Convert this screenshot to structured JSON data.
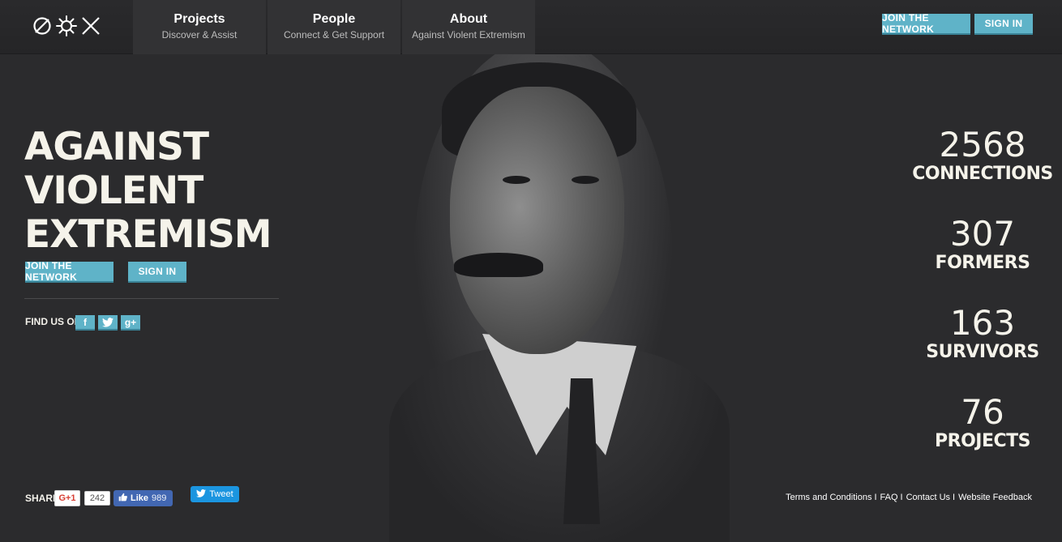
{
  "logo": {
    "icons": [
      "null-circle-icon",
      "starburst-icon",
      "x-cross-icon"
    ]
  },
  "nav": {
    "items": [
      {
        "title": "Projects",
        "subtitle": "Discover & Assist"
      },
      {
        "title": "People",
        "subtitle": "Connect & Get Support"
      },
      {
        "title": "About",
        "subtitle": "Against Violent Extremism"
      }
    ],
    "join_label": "JOIN THE NETWORK",
    "signin_label": "SIGN IN"
  },
  "hero": {
    "title_lines": [
      "AGAINST",
      "VIOLENT",
      "EXTREMISM"
    ],
    "join_label": "JOIN THE NETWORK",
    "signin_label": "SIGN IN",
    "find_us_label": "FIND US ON:",
    "social": {
      "facebook": "f",
      "twitter": "t",
      "googleplus": "g+"
    }
  },
  "stats": [
    {
      "value": "2568",
      "label": "CONNECTIONS"
    },
    {
      "value": "307",
      "label": "FORMERS"
    },
    {
      "value": "163",
      "label": "SURVIVORS"
    },
    {
      "value": "76",
      "label": "PROJECTS"
    }
  ],
  "share": {
    "label": "SHARE:",
    "gplus_label": "G+1",
    "gplus_count": "242",
    "fb_like_label": "Like",
    "fb_like_count": "989",
    "tweet_label": "Tweet"
  },
  "footer": {
    "links": [
      "Terms and Conditions",
      "FAQ",
      "Contact Us",
      "Website Feedback"
    ],
    "separator": "I"
  },
  "colors": {
    "background": "#2b2b2d",
    "accent": "#5fb3c8",
    "nav_item_bg": "#323234",
    "text": "#f5f3ea"
  }
}
